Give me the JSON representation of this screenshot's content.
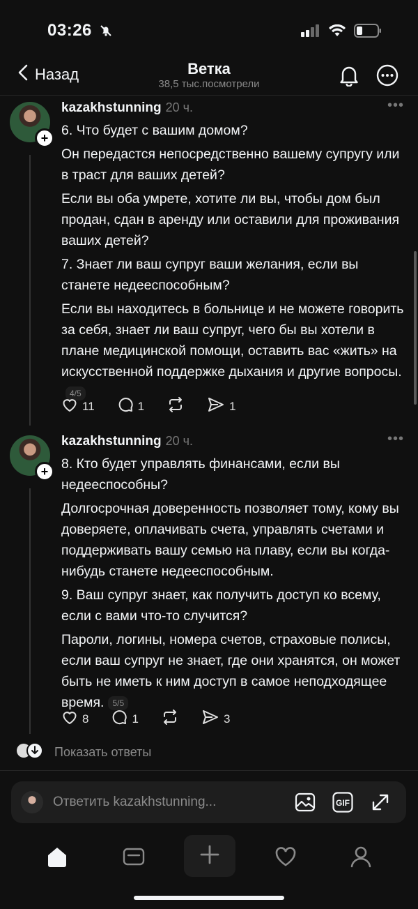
{
  "status_bar": {
    "time": "03:26"
  },
  "header": {
    "back_label": "Назад",
    "title": "Ветка",
    "subtitle": "38,5 тыс.посмотрели"
  },
  "posts": [
    {
      "username": "kazakhstunning",
      "time": "20 ч.",
      "paragraphs": [
        "6. Что будет с вашим домом?",
        "Он передастся непосредственно вашему супругу или в траст для ваших детей?",
        "Если вы оба умрете, хотите ли вы, чтобы дом был продан, сдан в аренду или оставили для проживания ваших детей?",
        "7. Знает ли ваш супруг ваши желания, если вы станете недееспособным?",
        "Если вы находитесь в больнице и не можете говорить за себя, знает ли ваш супруг, чего бы вы хотели в плане медицинской помощи, оставить вас «жить» на искусственной поддержке дыхания и другие вопросы."
      ],
      "pager": "4/5",
      "likes": "11",
      "comments": "1",
      "shares": "1"
    },
    {
      "username": "kazakhstunning",
      "time": "20 ч.",
      "paragraphs": [
        "8. Кто будет управлять финансами, если вы недееспособны?",
        "Долгосрочная доверенность позволяет тому, кому вы доверяете, оплачивать счета, управлять счетами и поддерживать вашу семью на плаву, если вы когда-нибудь станете недееспособным.",
        "9. Ваш супруг знает, как получить доступ ко всему, если с вами что-то случится?",
        "Пароли, логины, номера счетов, страховые полисы, если ваш супруг не знает, где они хранятся, он может быть не иметь к ним доступ в самое неподходящее время."
      ],
      "pager": "5/5",
      "likes": "8",
      "comments": "1",
      "shares": "3"
    }
  ],
  "show_replies": "Показать ответы",
  "reply_bar": {
    "placeholder": "Ответить kazakhstunning...",
    "gif_label": "GIF"
  },
  "icons": {
    "bell": "bell-icon",
    "more": "more-icon",
    "like": "heart-icon",
    "comment": "comment-icon",
    "repost": "repost-icon",
    "share": "send-icon",
    "image": "image-icon",
    "expand": "expand-icon",
    "home": "home-icon",
    "inbox": "inbox-icon",
    "create": "plus-icon",
    "activity": "heart-icon",
    "profile": "profile-icon"
  }
}
